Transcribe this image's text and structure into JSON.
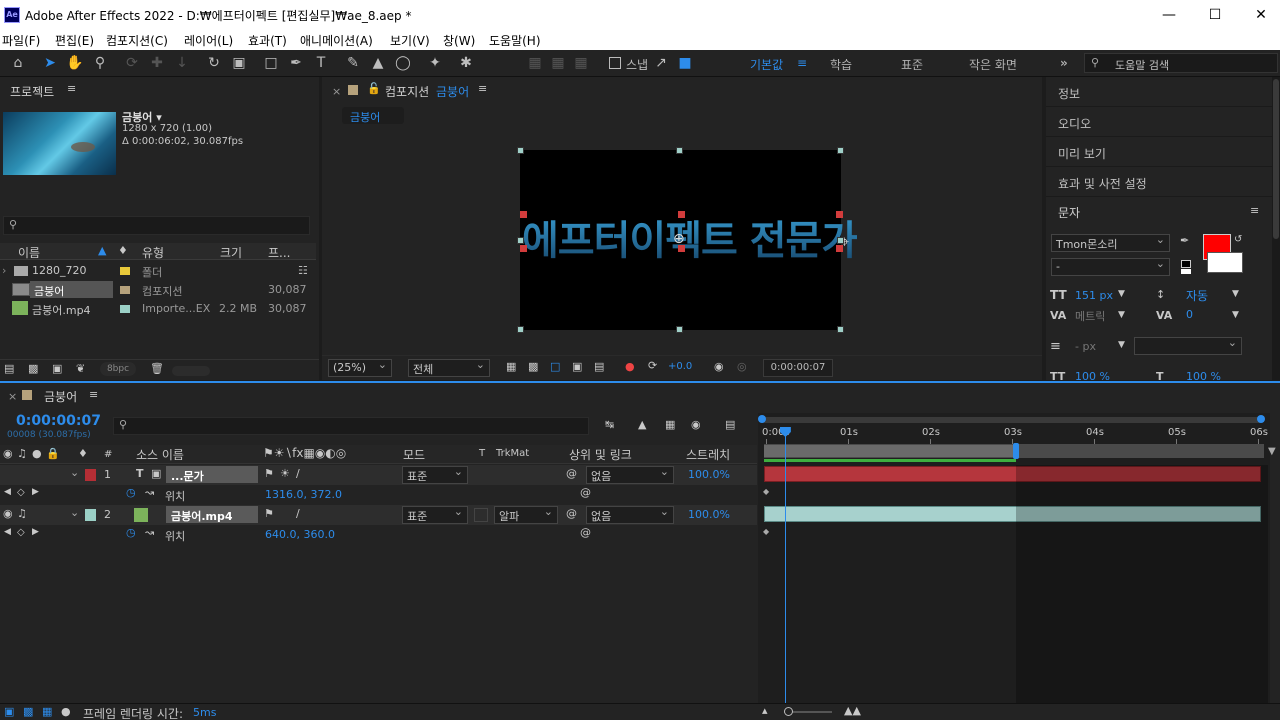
{
  "app": {
    "logo": "Ae",
    "title": "Adobe After Effects 2022 - D:₩에프터이펙트 [편집실무]₩ae_8.aep *"
  },
  "menu": [
    "파일(F)",
    "편집(E)",
    "컴포지션(C)",
    "레이어(L)",
    "효과(T)",
    "애니메이션(A)",
    "보기(V)",
    "창(W)",
    "도움말(H)"
  ],
  "toolbar": {
    "snap_label": "스냅",
    "workspaces": [
      "기본값",
      "학습",
      "표준",
      "작은 화면"
    ],
    "search_placeholder": "도움말 검색",
    "accent": "#2d8ceb"
  },
  "project": {
    "title": "프로젝트",
    "selected_name": "금붕어 ▾",
    "selected_dims": "1280 x 720 (1.00)",
    "selected_dur": "Δ 0:00:06:02, 30.087fps",
    "columns": [
      "이름",
      "유형",
      "크기",
      "프..."
    ],
    "items": [
      {
        "name": "1280_720",
        "type": "폴더",
        "size": "",
        "fps": "",
        "color": "#e8c93a",
        "icon": "folder-icon"
      },
      {
        "name": "금붕어",
        "type": "컴포지션",
        "size": "",
        "fps": "30,087",
        "color": "#b6a27c",
        "icon": "composition-icon"
      },
      {
        "name": "금붕어.mp4",
        "type": "Importe...EX",
        "size": "2.2 MB",
        "fps": "30,087",
        "color": "#9bd0c6",
        "icon": "footage-icon"
      }
    ],
    "bpc": "8bpc"
  },
  "viewer": {
    "tab_prefix": "컴포지션",
    "tab_comp": "금붕어",
    "breadcrumb": "금붕어",
    "text_layer": "에프터이펙트 전문가",
    "zoom": "(25%)",
    "resolution": "전체",
    "exposure": "+0.0",
    "timecode": "0:00:00:07"
  },
  "right_panels": [
    "정보",
    "오디오",
    "미리 보기",
    "효과 및 사전 설정",
    "문자"
  ],
  "character": {
    "font": "Tmon몬소리",
    "style": "-",
    "size": "151 px",
    "leading": "자동",
    "kerning": "메트릭",
    "tracking": "0",
    "stroke_unit": "- px",
    "vscale": "100 %",
    "hscale": "100 %",
    "fill_color": "#ff0000"
  },
  "timeline": {
    "comp_name": "금붕어",
    "timecode": "0:00:00:07",
    "frame_info": "00008 (30.087fps)",
    "columns": {
      "num": "#",
      "source": "소스 이름",
      "mode": "모드",
      "t": "T",
      "trkmat": "TrkMat",
      "parent": "상위 및 링크",
      "stretch": "스트레치"
    },
    "layers": [
      {
        "num": "1",
        "name": "...문가",
        "mode": "표준",
        "trkmat": "",
        "parent": "없음",
        "stretch": "100.0%",
        "color": "#b52e35",
        "prop": "위치",
        "value": "1316.0, 372.0"
      },
      {
        "num": "2",
        "name": "금붕어.mp4",
        "mode": "표준",
        "trkmat": "알파",
        "parent": "없음",
        "stretch": "100.0%",
        "color": "#9bd0c6",
        "prop": "위치",
        "value": "640.0, 360.0"
      }
    ],
    "ruler": [
      "0:00s",
      "01s",
      "02s",
      "03s",
      "04s",
      "05s",
      "06s"
    ],
    "current_time_sec": 0.23,
    "work_area_end_sec": 3.05,
    "duration_sec": 6.07
  },
  "status": {
    "render_label": "프레임 렌더링 시간:",
    "render_value": "5ms"
  }
}
